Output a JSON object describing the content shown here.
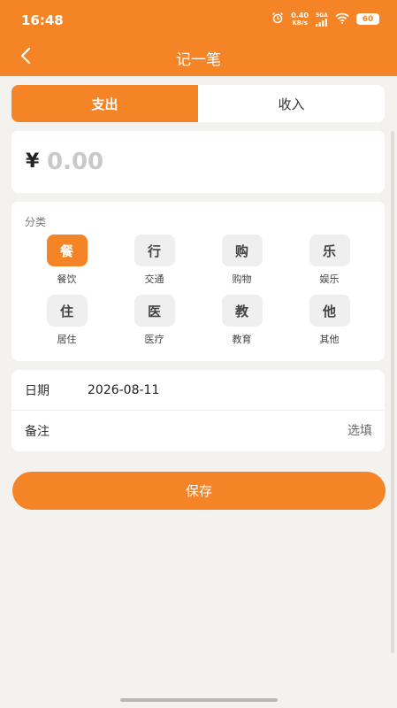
{
  "status_bar": {
    "time": "16:48",
    "network_speed_value": "0.40",
    "network_speed_unit": "KB/s",
    "signal_label": "5GA",
    "battery": "60",
    "icons": [
      "alarm-icon",
      "signal-icon",
      "wifi-icon",
      "battery-icon"
    ]
  },
  "header": {
    "title": "记一笔",
    "back_icon": "chevron-left-icon"
  },
  "tabs": [
    {
      "label": "支出",
      "active": true
    },
    {
      "label": "收入",
      "active": false
    }
  ],
  "amount": {
    "currency_symbol": "¥",
    "placeholder": "0.00",
    "value": ""
  },
  "category": {
    "title": "分类",
    "items": [
      {
        "icon_char": "餐",
        "label": "餐饮",
        "selected": true
      },
      {
        "icon_char": "行",
        "label": "交通",
        "selected": false
      },
      {
        "icon_char": "购",
        "label": "购物",
        "selected": false
      },
      {
        "icon_char": "乐",
        "label": "娱乐",
        "selected": false
      },
      {
        "icon_char": "住",
        "label": "居住",
        "selected": false
      },
      {
        "icon_char": "医",
        "label": "医疗",
        "selected": false
      },
      {
        "icon_char": "教",
        "label": "教育",
        "selected": false
      },
      {
        "icon_char": "他",
        "label": "其他",
        "selected": false
      }
    ]
  },
  "details": {
    "date_label": "日期",
    "date_value": "2026-08-11",
    "note_label": "备注",
    "note_placeholder": "选填"
  },
  "save_label": "保存",
  "colors": {
    "accent": "#f58427",
    "background": "#f3f2ef",
    "card": "#ffffff",
    "placeholder": "#c9c9c9"
  }
}
